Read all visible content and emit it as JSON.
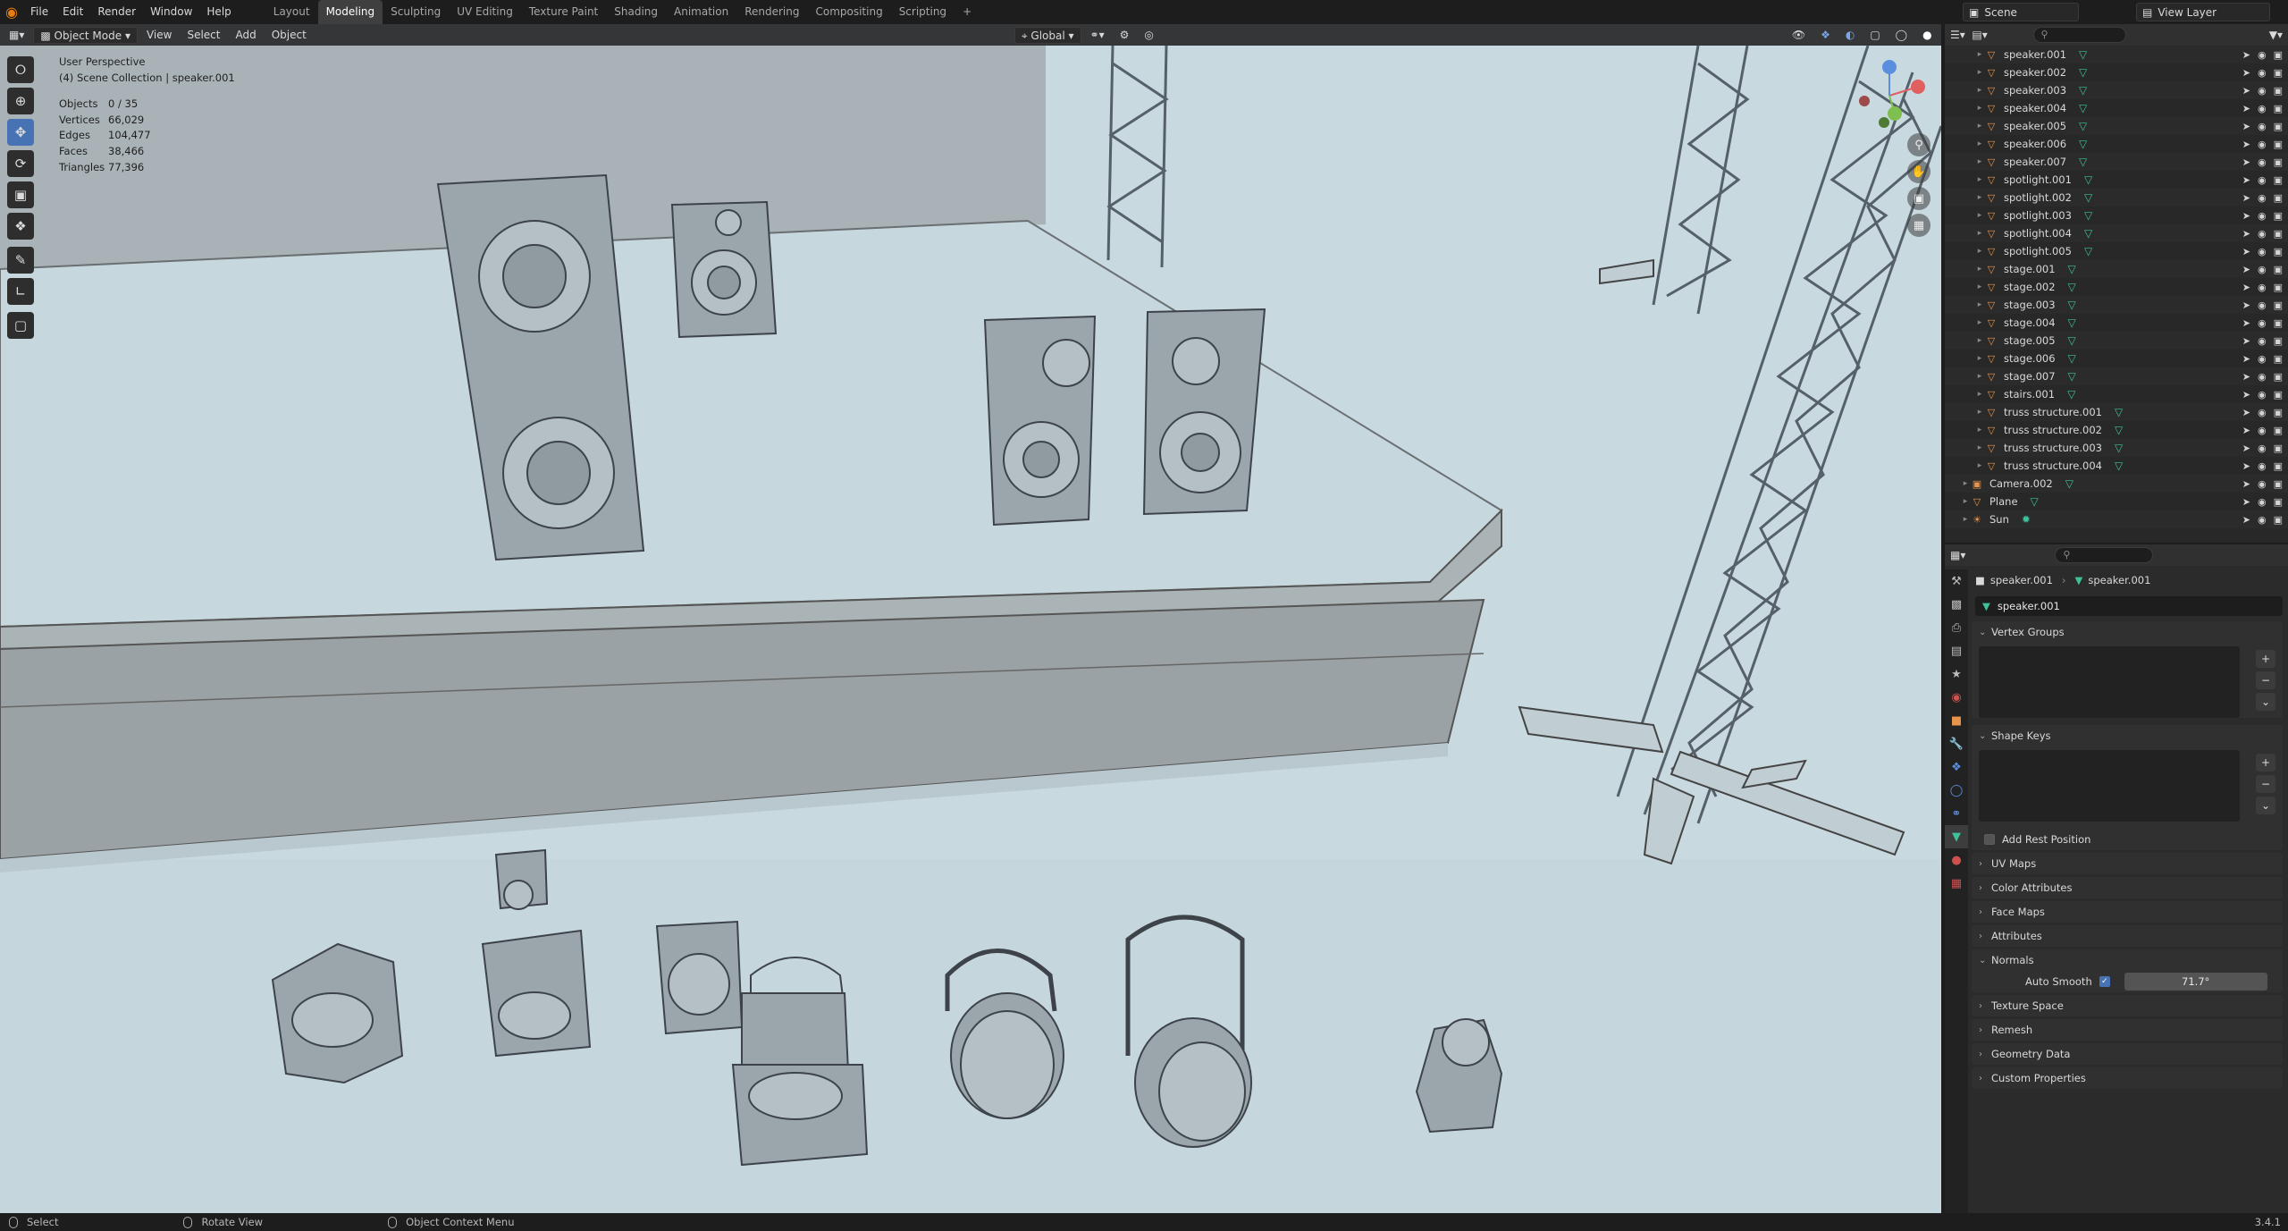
{
  "menus": [
    "File",
    "Edit",
    "Render",
    "Window",
    "Help"
  ],
  "workspaces": [
    "Layout",
    "Modeling",
    "Sculpting",
    "UV Editing",
    "Texture Paint",
    "Shading",
    "Animation",
    "Rendering",
    "Compositing",
    "Scripting",
    "+"
  ],
  "active_workspace": "Modeling",
  "scene": {
    "name": "Scene",
    "view_layer": "View Layer"
  },
  "viewport_header": {
    "mode": "Object Mode",
    "menus": [
      "View",
      "Select",
      "Add",
      "Object"
    ],
    "orientation": "Global"
  },
  "overlay": {
    "view_name": "User Perspective",
    "collection_line": "(4) Scene Collection | speaker.001",
    "stats": [
      {
        "label": "Objects",
        "value": "0 / 35"
      },
      {
        "label": "Vertices",
        "value": "66,029"
      },
      {
        "label": "Edges",
        "value": "104,477"
      },
      {
        "label": "Faces",
        "value": "38,466"
      },
      {
        "label": "Triangles",
        "value": "77,396"
      }
    ]
  },
  "tools": [
    "select-box",
    "cursor",
    "move",
    "rotate",
    "scale",
    "transform",
    "annotate",
    "measure",
    "add-cube"
  ],
  "outliner": {
    "items": [
      {
        "name": "speaker.001",
        "type": "mesh",
        "level": 2
      },
      {
        "name": "speaker.002",
        "type": "mesh",
        "level": 2
      },
      {
        "name": "speaker.003",
        "type": "mesh",
        "level": 2
      },
      {
        "name": "speaker.004",
        "type": "mesh",
        "level": 2
      },
      {
        "name": "speaker.005",
        "type": "mesh",
        "level": 2
      },
      {
        "name": "speaker.006",
        "type": "mesh",
        "level": 2
      },
      {
        "name": "speaker.007",
        "type": "mesh",
        "level": 2
      },
      {
        "name": "spotlight.001",
        "type": "mesh",
        "level": 2
      },
      {
        "name": "spotlight.002",
        "type": "mesh",
        "level": 2
      },
      {
        "name": "spotlight.003",
        "type": "mesh",
        "level": 2
      },
      {
        "name": "spotlight.004",
        "type": "mesh",
        "level": 2
      },
      {
        "name": "spotlight.005",
        "type": "mesh",
        "level": 2
      },
      {
        "name": "stage.001",
        "type": "mesh",
        "level": 2
      },
      {
        "name": "stage.002",
        "type": "mesh",
        "level": 2
      },
      {
        "name": "stage.003",
        "type": "mesh",
        "level": 2
      },
      {
        "name": "stage.004",
        "type": "mesh",
        "level": 2
      },
      {
        "name": "stage.005",
        "type": "mesh",
        "level": 2
      },
      {
        "name": "stage.006",
        "type": "mesh",
        "level": 2
      },
      {
        "name": "stage.007",
        "type": "mesh",
        "level": 2
      },
      {
        "name": "stairs.001",
        "type": "mesh",
        "level": 2
      },
      {
        "name": "truss structure.001",
        "type": "mesh",
        "level": 2
      },
      {
        "name": "truss structure.002",
        "type": "mesh",
        "level": 2
      },
      {
        "name": "truss structure.003",
        "type": "mesh",
        "level": 2
      },
      {
        "name": "truss structure.004",
        "type": "mesh",
        "level": 2
      },
      {
        "name": "Camera.002",
        "type": "camera",
        "level": 1
      },
      {
        "name": "Plane",
        "type": "mesh",
        "level": 1
      },
      {
        "name": "Sun",
        "type": "light",
        "level": 1
      }
    ]
  },
  "properties": {
    "breadcrumb": {
      "object": "speaker.001",
      "data": "speaker.001"
    },
    "mesh_name": "speaker.001",
    "vertex_groups": "Vertex Groups",
    "shape_keys": "Shape Keys",
    "add_rest_position": "Add Rest Position",
    "collapsed_panels": [
      "UV Maps",
      "Color Attributes",
      "Face Maps",
      "Attributes"
    ],
    "normals": {
      "title": "Normals",
      "auto_smooth_label": "Auto Smooth",
      "auto_smooth_value": "71.7°"
    },
    "bottom_panels": [
      "Texture Space",
      "Remesh",
      "Geometry Data",
      "Custom Properties"
    ]
  },
  "status": {
    "items": [
      "Select",
      "Rotate View",
      "Object Context Menu"
    ],
    "version": "3.4.1"
  },
  "colors": {
    "accent": "#4772b3",
    "viewport_bg": "#c5d6dd",
    "mesh_icon": "#3fbf9a",
    "object_icon": "#e8944a"
  }
}
